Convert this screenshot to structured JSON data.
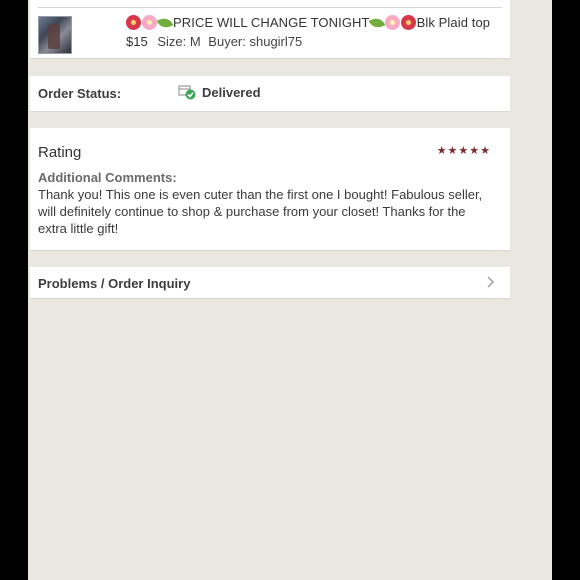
{
  "item": {
    "title": "PRICE WILL CHANGE TONIGHT",
    "title_suffix": "Blk Plaid top",
    "price": "$15",
    "size": "Size: M",
    "buyer": "Buyer: shugirl75"
  },
  "order_status": {
    "label": "Order Status:",
    "value": "Delivered",
    "icon": "delivered-box-check-icon"
  },
  "rating": {
    "title": "Rating",
    "stars": "★★★★★",
    "stars_value": 5,
    "comments_label": "Additional Comments:",
    "comments_text": "Thank you! This one is even cuter than the first one I bought! Fabulous seller, will definitely continue to shop & purchase from your closet! Thanks for the extra little gift!"
  },
  "problems": {
    "label": "Problems / Order Inquiry",
    "icon": "chevron-right-icon"
  },
  "colors": {
    "background": "#eae7e1",
    "card": "#ffffff",
    "star": "#7c2a33",
    "delivered_check": "#3aa655"
  }
}
